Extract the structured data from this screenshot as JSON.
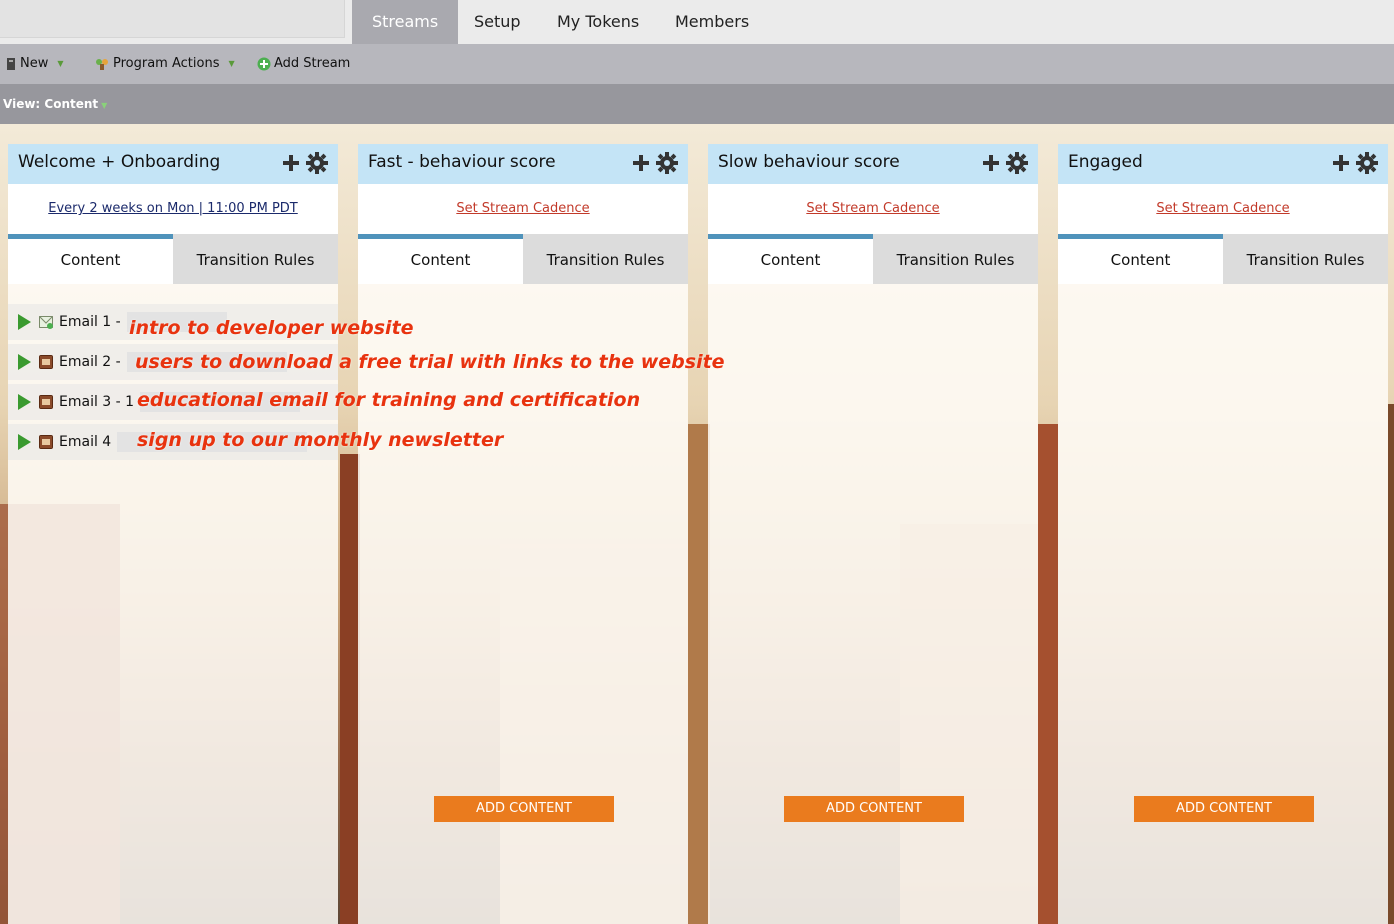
{
  "top_tabs": [
    "Streams",
    "Setup",
    "My Tokens",
    "Members"
  ],
  "toolbar": {
    "new_label": "New",
    "program_actions_label": "Program Actions",
    "add_stream_label": "Add Stream"
  },
  "view": {
    "label": "View: Content"
  },
  "streams": [
    {
      "title": "Welcome + Onboarding",
      "cadence": "Every 2 weeks on Mon | 11:00 PM PDT",
      "tabs": [
        "Content",
        "Transition Rules"
      ],
      "items": [
        {
          "label": "Email 1 -"
        },
        {
          "label": "Email 2 -"
        },
        {
          "label": "Email 3 - 1"
        },
        {
          "label": "Email 4"
        }
      ]
    },
    {
      "title": "Fast - behaviour score",
      "cadence": "Set Stream Cadence",
      "tabs": [
        "Content",
        "Transition Rules"
      ],
      "add_content": "ADD CONTENT"
    },
    {
      "title": "Slow behaviour score",
      "cadence": "Set Stream Cadence",
      "tabs": [
        "Content",
        "Transition Rules"
      ],
      "add_content": "ADD CONTENT"
    },
    {
      "title": "Engaged",
      "cadence": "Set Stream Cadence",
      "tabs": [
        "Content",
        "Transition Rules"
      ],
      "add_content": "ADD CONTENT"
    }
  ],
  "annotations": [
    "intro to developer website",
    "users to download a free trial with links to the website",
    "educational email for training and certification",
    "sign up to our monthly newsletter"
  ]
}
